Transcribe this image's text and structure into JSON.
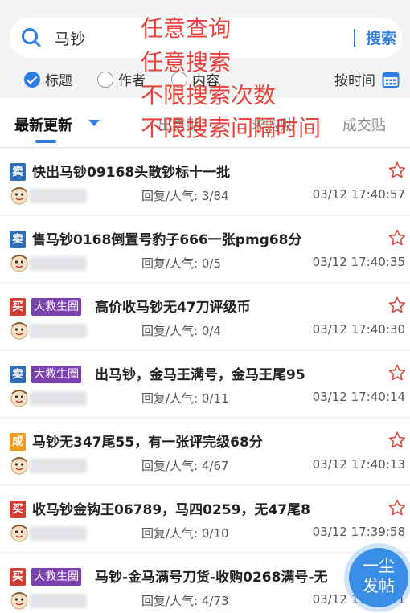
{
  "search": {
    "value": "马钞",
    "button": "搜索"
  },
  "filters": {
    "options": [
      {
        "label": "标题",
        "checked": true
      },
      {
        "label": "作者",
        "checked": false
      },
      {
        "label": "内容",
        "checked": false
      }
    ],
    "sort_label": "按时间"
  },
  "overlay_text": [
    "任意查询",
    "任意搜索",
    "不限搜索次数",
    "不限搜索间隔时间"
  ],
  "tabs": [
    {
      "label": "最新更新",
      "active": true
    },
    {
      "label": "出售贴",
      "active": false
    },
    {
      "label": "求购贴",
      "active": false
    },
    {
      "label": "成交贴",
      "active": false
    }
  ],
  "posts": [
    {
      "badge": "卖",
      "type": "sell",
      "tag": "",
      "title": "快出马钞09168头散钞标十一批",
      "stats": "回复/人气: 3/84",
      "time": "03/12 17:40:57"
    },
    {
      "badge": "卖",
      "type": "sell",
      "tag": "",
      "title": "售马钞0168倒置号豹子666一张pmg68分",
      "stats": "回复/人气: 0/5",
      "time": "03/12 17:40:35"
    },
    {
      "badge": "买",
      "type": "buy",
      "tag": "大救生圈",
      "title": "高价收马钞无47刀评级币",
      "stats": "回复/人气: 0/4",
      "time": "03/12 17:40:30"
    },
    {
      "badge": "卖",
      "type": "sell",
      "tag": "大救生圈",
      "title": "出马钞，金马王满号，金马王尾95",
      "stats": "回复/人气: 0/11",
      "time": "03/12 17:40:14"
    },
    {
      "badge": "成",
      "type": "done",
      "tag": "",
      "title": "马钞无347尾55，有一张评完级68分",
      "stats": "回复/人气: 4/67",
      "time": "03/12 17:40:13"
    },
    {
      "badge": "买",
      "type": "buy",
      "tag": "",
      "title": "收马钞金钩王06789，马四0259，无47尾8",
      "stats": "回复/人气: 0/10",
      "time": "03/12 17:39:58"
    },
    {
      "badge": "买",
      "type": "buy",
      "tag": "大救生圈",
      "title": "马钞-金马满号刀货-收购0268满号-无",
      "stats": "回复/人气: 4/73",
      "time": "03/12 17:39:51"
    }
  ],
  "fab": {
    "line1": "一尘",
    "line2": "发帖"
  },
  "colors": {
    "accent": "#2f7de1",
    "sell": "#2e6db5",
    "buy": "#d23b2f",
    "done": "#ef9b1f",
    "tag": "#7a3fb0",
    "overlay": "#e8332a"
  }
}
